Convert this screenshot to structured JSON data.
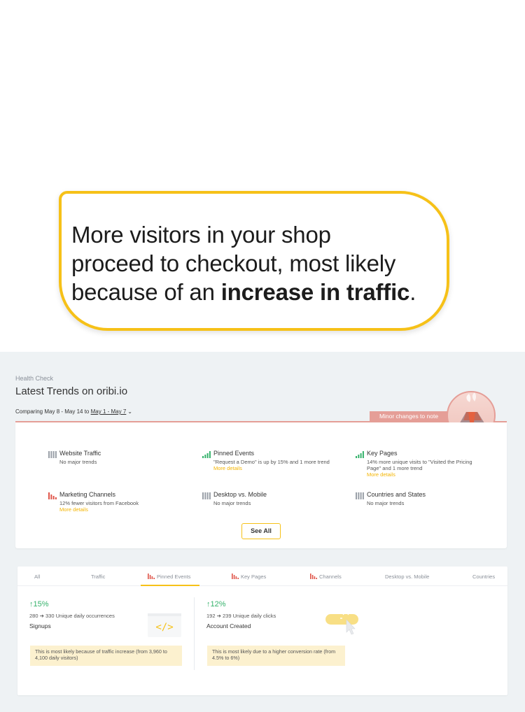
{
  "callout": {
    "line1": "More visitors in your shop",
    "line2": "proceed to checkout, most likely",
    "line3_prefix": "because of an ",
    "line3_bold": "increase in traffic",
    "line3_suffix": "."
  },
  "header": {
    "label": "Health Check",
    "title": "Latest Trends on oribi.io",
    "comparing_prefix": "Comparing May 8 - May 14 to ",
    "comparing_range": "May 1 - May 7",
    "status_tag": "Minor changes to note"
  },
  "trends": [
    {
      "name": "Website Traffic",
      "desc": "No major trends",
      "more": "",
      "icon_color": "#9aa0a8"
    },
    {
      "name": "Pinned Events",
      "desc": "\"Request a Demo\" is up by 15% and 1 more trend",
      "more": "More details",
      "icon_color": "#35b26b"
    },
    {
      "name": "Key Pages",
      "desc": "14% more unique visits to \"Visited the Pricing Page\" and 1 more trend",
      "more": "More details",
      "icon_color": "#35b26b"
    },
    {
      "name": "Marketing Channels",
      "desc": "12% fewer visitors from Facebook",
      "more": "More details",
      "icon_color": "#e0554a"
    },
    {
      "name": "Desktop vs. Mobile",
      "desc": "No major trends",
      "more": "",
      "icon_color": "#9aa0a8"
    },
    {
      "name": "Countries and States",
      "desc": "No major trends",
      "more": "",
      "icon_color": "#9aa0a8"
    }
  ],
  "see_all_label": "See All",
  "tabs": [
    {
      "label": "All"
    },
    {
      "label": "Traffic"
    },
    {
      "label": "Pinned Events",
      "active": true
    },
    {
      "label": "Key Pages"
    },
    {
      "label": "Channels"
    },
    {
      "label": "Desktop vs. Mobile"
    },
    {
      "label": "Countries"
    }
  ],
  "metrics": [
    {
      "pct": "15%",
      "from": "280",
      "to": "330",
      "unit": "Unique daily occurrences",
      "event": "Signups",
      "note": "This is most likely because of traffic increase (from  3,960 to 4,100 daily visitors)"
    },
    {
      "pct": "12%",
      "from": "192",
      "to": "239",
      "unit": "Unique daily clicks",
      "event": "Account Created",
      "note": "This is most likely due to a higher conversion rate (from 4.5% to 6%)"
    }
  ],
  "colors": {
    "accent": "#f6c118",
    "warning_pink": "#e59e97",
    "up_green": "#35b26b",
    "down_red": "#e0554a",
    "link_yellow": "#f4b400"
  }
}
